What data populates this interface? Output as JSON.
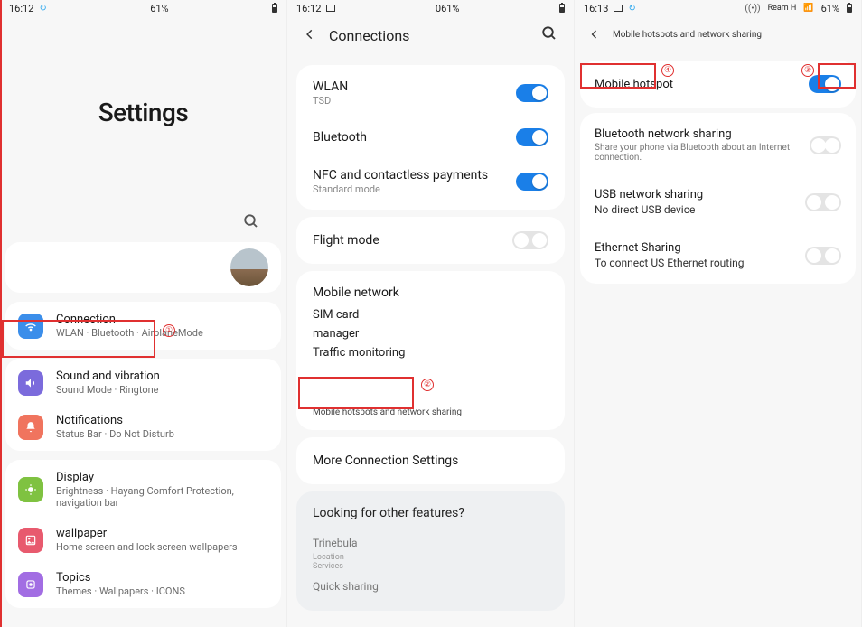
{
  "panel1": {
    "status": {
      "time": "16:12",
      "battery": "61%"
    },
    "title": "Settings",
    "items": {
      "connection": {
        "title": "Connection",
        "sub": "WLAN · Bluetooth · AirplaneMode"
      },
      "sound": {
        "title": "Sound and vibration",
        "sub": "Sound Mode · Ringtone"
      },
      "notifications": {
        "title": "Notifications",
        "sub": "Status Bar · Do Not Disturb"
      },
      "display": {
        "title": "Display",
        "sub": "Brightness · Hayang Comfort Protection, navigation bar"
      },
      "wallpaper": {
        "title": "wallpaper",
        "sub": "Home screen and lock screen wallpapers"
      },
      "topics": {
        "title": "Topics",
        "sub": "Themes · Wallpapers · ICONS"
      }
    },
    "annotation1": "①"
  },
  "panel2": {
    "status": {
      "time": "16:12",
      "battery": "061%"
    },
    "header": "Connections",
    "wlan": {
      "title": "WLAN",
      "sub": "TSD"
    },
    "bluetooth": {
      "title": "Bluetooth"
    },
    "nfc": {
      "title": "NFC and contactless payments",
      "sub": "Standard mode"
    },
    "flight": {
      "title": "Flight mode"
    },
    "mobile": {
      "title": "Mobile network",
      "sim": "SIM card",
      "manager": "manager",
      "traffic": "Traffic monitoring"
    },
    "hotspots": "Mobile hotspots and network sharing",
    "more": "More Connection Settings",
    "looking": {
      "title": "Looking for other features?",
      "item1": "Trinebula",
      "item2a": "Location",
      "item2b": "Services",
      "item3": "Quick sharing"
    },
    "annotation2": "②"
  },
  "panel3": {
    "status": {
      "time": "16:13",
      "carrier": "Ream H",
      "battery": "61%"
    },
    "header": "Mobile hotspots and network sharing",
    "hotspot": {
      "title": "Mobile hotspot"
    },
    "btshare": {
      "title": "Bluetooth network sharing",
      "sub": "Share your phone via Bluetooth about an Internet connection."
    },
    "usb": {
      "title": "USB network sharing",
      "sub": "No direct USB device"
    },
    "eth": {
      "title": "Ethernet Sharing",
      "sub": "To connect US Ethernet routing"
    },
    "annotation3": "③",
    "annotation4": "④"
  }
}
